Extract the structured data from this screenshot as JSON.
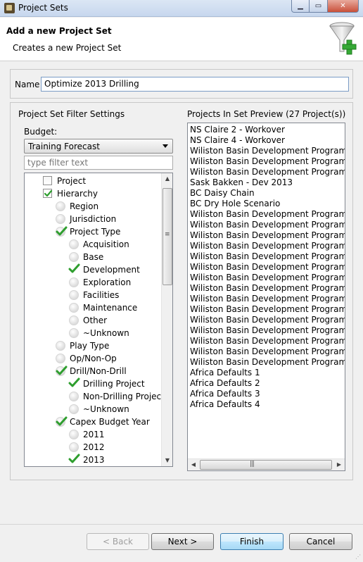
{
  "window": {
    "title": "Project Sets"
  },
  "header": {
    "title": "Add a new Project Set",
    "subtitle": "Creates a new Project Set"
  },
  "name_field": {
    "label": "Name",
    "value": "Optimize 2013 Drilling"
  },
  "filter_settings": {
    "title": "Project Set Filter Settings",
    "budget_label": "Budget:",
    "budget_selected": "Training Forecast",
    "filter_placeholder": "type filter text",
    "tree": [
      {
        "label": "Project",
        "level": 1,
        "state": "checkbox-unchecked"
      },
      {
        "label": "Hierarchy",
        "level": 1,
        "state": "checkbox-checked"
      },
      {
        "label": "Region",
        "level": 2,
        "state": "empty"
      },
      {
        "label": "Jurisdiction",
        "level": 2,
        "state": "empty"
      },
      {
        "label": "Project Type",
        "level": 2,
        "state": "partial"
      },
      {
        "label": "Acquisition",
        "level": 3,
        "state": "empty"
      },
      {
        "label": "Base",
        "level": 3,
        "state": "empty"
      },
      {
        "label": "Development",
        "level": 3,
        "state": "checked"
      },
      {
        "label": "Exploration",
        "level": 3,
        "state": "empty"
      },
      {
        "label": "Facilities",
        "level": 3,
        "state": "empty"
      },
      {
        "label": "Maintenance",
        "level": 3,
        "state": "empty"
      },
      {
        "label": "Other",
        "level": 3,
        "state": "empty"
      },
      {
        "label": "~Unknown",
        "level": 3,
        "state": "empty"
      },
      {
        "label": "Play Type",
        "level": 2,
        "state": "empty"
      },
      {
        "label": "Op/Non-Op",
        "level": 2,
        "state": "empty"
      },
      {
        "label": "Drill/Non-Drill",
        "level": 2,
        "state": "partial"
      },
      {
        "label": "Drilling Project",
        "level": 3,
        "state": "checked"
      },
      {
        "label": "Non-Drilling Project",
        "level": 3,
        "state": "empty"
      },
      {
        "label": "~Unknown",
        "level": 3,
        "state": "empty"
      },
      {
        "label": "Capex Budget Year",
        "level": 2,
        "state": "partial"
      },
      {
        "label": "2011",
        "level": 3,
        "state": "empty"
      },
      {
        "label": "2012",
        "level": 3,
        "state": "empty"
      },
      {
        "label": "2013",
        "level": 3,
        "state": "checked"
      }
    ]
  },
  "preview": {
    "title": "Projects In Set Preview (27 Project(s))",
    "items": [
      "NS Claire 2 - Workover",
      "NS Claire 4 - Workover",
      "Wiliston Basin Development Program \"A\"",
      "Wiliston Basin Development Program \"B\"",
      "Wiliston Basin Development Program \"C\"",
      "Sask Bakken - Dev 2013",
      "BC Daisy Chain",
      "BC Dry Hole Scenario",
      "Wiliston Basin Development Program \"D\"",
      "Wiliston Basin Development Program \"F\"",
      "Wiliston Basin Development Program \"E\"",
      "Wiliston Basin Development Program \"G\"",
      "Wiliston Basin Development Program \"H\"",
      "Wiliston Basin Development Program \"I\"",
      "Wiliston Basin Development Program \"J\"",
      "Wiliston Basin Development Program \"K\"",
      "Wiliston Basin Development Program \"L\"",
      "Wiliston Basin Development Program \"M\"",
      "Wiliston Basin Development Program \"N\"",
      "Wiliston Basin Development Program \"O\"",
      "Wiliston Basin Development Program \"P\"",
      "Wiliston Basin Development Program \"Q\"",
      "Wiliston Basin Development Program \"R\"",
      "Africa Defaults 1",
      "Africa Defaults 2",
      "Africa Defaults 3",
      "Africa Defaults 4"
    ]
  },
  "buttons": {
    "back": "< Back",
    "next": "Next >",
    "finish": "Finish",
    "cancel": "Cancel"
  },
  "icons": {
    "title_bar": "app-icon",
    "header": "funnel-add-icon",
    "check_color": "#2e9e2e"
  }
}
